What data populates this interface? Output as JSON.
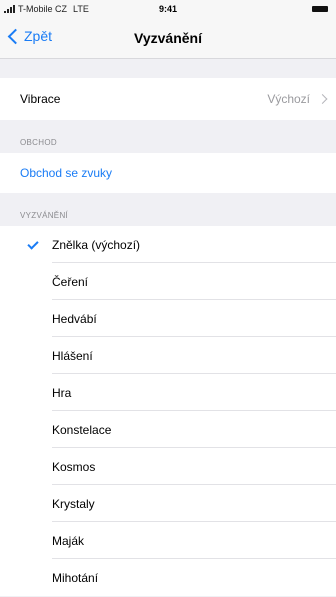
{
  "status_bar": {
    "carrier": "T-Mobile CZ",
    "network": "LTE",
    "time": "9:41"
  },
  "nav": {
    "back_label": "Zpět",
    "title": "Vyzvánění"
  },
  "vibration": {
    "label": "Vibrace",
    "value": "Výchozí"
  },
  "store": {
    "header": "OBCHOD",
    "link_label": "Obchod se zvuky"
  },
  "ringtones": {
    "header": "VYZVÁNĚNÍ",
    "selected": "Znělka (výchozí)",
    "items": [
      "Znělka (výchozí)",
      "Čeření",
      "Hedvábí",
      "Hlášení",
      "Hra",
      "Konstelace",
      "Kosmos",
      "Krystaly",
      "Maják",
      "Mihotání"
    ]
  },
  "colors": {
    "accent": "#1a7cf5",
    "background": "#f0f0f4"
  }
}
